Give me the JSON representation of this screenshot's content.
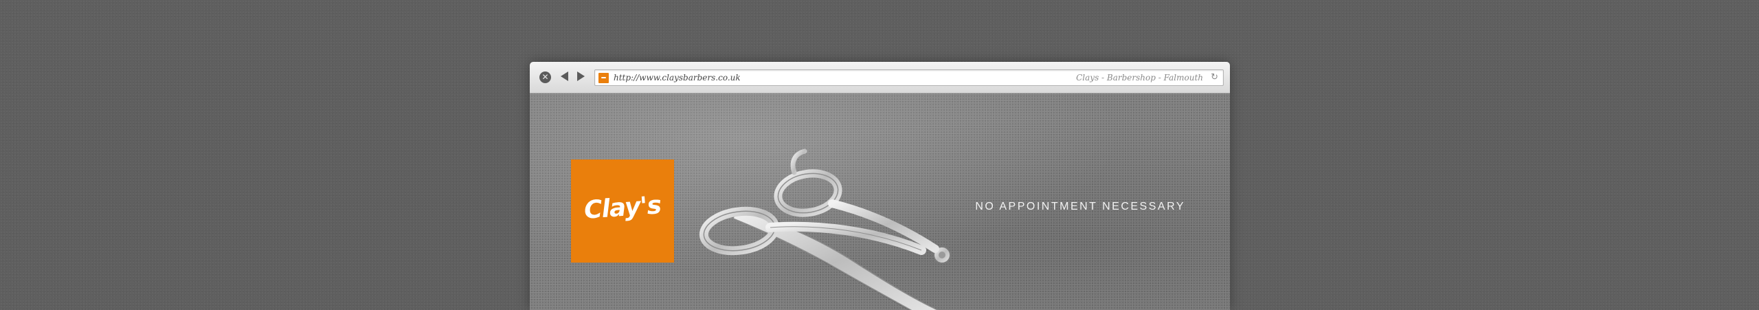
{
  "browser": {
    "url": "http://www.claysbarbers.co.uk",
    "page_title": "Clays - Barbershop - Falmouth",
    "icons": {
      "close": "close-icon",
      "back": "back-arrow-icon",
      "forward": "forward-arrow-icon",
      "favicon": "site-favicon-icon",
      "reload": "reload-icon"
    }
  },
  "hero": {
    "logo_text": "Clay's",
    "tagline": "NO APPOINTMENT NECESSARY",
    "accent_color": "#ea7f0c"
  }
}
